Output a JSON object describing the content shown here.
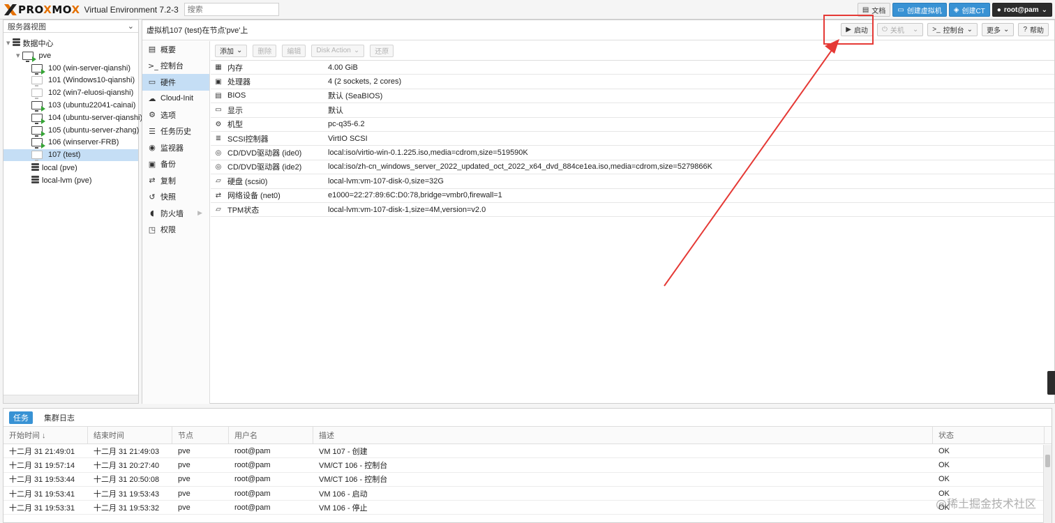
{
  "header": {
    "brand_main": "PRO",
    "brand_x2": "X",
    "brand_end": "MO",
    "brand_x3": "X",
    "version": "Virtual Environment 7.2-3",
    "search_placeholder": "搜索",
    "docs": "文档",
    "create_vm": "创建虚拟机",
    "create_ct": "创建CT",
    "user": "root@pam"
  },
  "tree": {
    "view": "服务器视图",
    "datacenter": "数据中心",
    "node": "pve",
    "vms": [
      {
        "label": "100 (win-server-qianshi)",
        "state": "running"
      },
      {
        "label": "101 (Windows10-qianshi)",
        "state": "stopped"
      },
      {
        "label": "102 (win7-eluosi-qianshi)",
        "state": "stopped"
      },
      {
        "label": "103 (ubuntu22041-cainai)",
        "state": "running"
      },
      {
        "label": "104 (ubuntu-server-qianshi)",
        "state": "running"
      },
      {
        "label": "105 (ubuntu-server-zhang)",
        "state": "running"
      },
      {
        "label": "106 (winserver-FRB)",
        "state": "running"
      },
      {
        "label": "107 (test)",
        "state": "selected"
      }
    ],
    "storage": [
      "local (pve)",
      "local-lvm (pve)"
    ]
  },
  "content": {
    "title": "虚拟机107 (test)在节点'pve'上",
    "buttons": {
      "start": "启动",
      "shutdown": "关机",
      "console": "控制台",
      "more": "更多",
      "help": "帮助"
    },
    "menu": [
      {
        "label": "概要",
        "icon": "book-icon"
      },
      {
        "label": "控制台",
        "icon": "terminal-icon"
      },
      {
        "label": "硬件",
        "icon": "desktop-icon"
      },
      {
        "label": "Cloud-Init",
        "icon": "cloud-icon"
      },
      {
        "label": "选项",
        "icon": "gear-icon"
      },
      {
        "label": "任务历史",
        "icon": "list-icon"
      },
      {
        "label": "监视器",
        "icon": "eye-icon"
      },
      {
        "label": "备份",
        "icon": "floppy-icon"
      },
      {
        "label": "复制",
        "icon": "retweet-icon"
      },
      {
        "label": "快照",
        "icon": "history-icon"
      },
      {
        "label": "防火墙",
        "icon": "shield-icon"
      },
      {
        "label": "权限",
        "icon": "unlock-icon"
      }
    ],
    "hw_toolbar": {
      "add": "添加",
      "remove": "删除",
      "edit": "编辑",
      "disk_action": "Disk Action",
      "revert": "还原"
    },
    "hardware": [
      {
        "name": "内存",
        "value": "4.00 GiB",
        "icon": "memory-icon"
      },
      {
        "name": "处理器",
        "value": "4 (2 sockets, 2 cores)",
        "icon": "cpu-icon"
      },
      {
        "name": "BIOS",
        "value": "默认 (SeaBIOS)",
        "icon": "microchip-icon"
      },
      {
        "name": "显示",
        "value": "默认",
        "icon": "monitor-icon"
      },
      {
        "name": "机型",
        "value": "pc-q35-6.2",
        "icon": "cogs-icon"
      },
      {
        "name": "SCSI控制器",
        "value": "VirtIO SCSI",
        "icon": "database-icon"
      },
      {
        "name": "CD/DVD驱动器 (ide0)",
        "value": "local:iso/virtio-win-0.1.225.iso,media=cdrom,size=519590K",
        "icon": "cdrom-icon"
      },
      {
        "name": "CD/DVD驱动器 (ide2)",
        "value": "local:iso/zh-cn_windows_server_2022_updated_oct_2022_x64_dvd_884ce1ea.iso,media=cdrom,size=5279866K",
        "icon": "cdrom-icon"
      },
      {
        "name": "硬盘 (scsi0)",
        "value": "local-lvm:vm-107-disk-0,size=32G",
        "icon": "hdd-icon"
      },
      {
        "name": "网络设备 (net0)",
        "value": "e1000=22:27:89:6C:D0:78,bridge=vmbr0,firewall=1",
        "icon": "exchange-icon"
      },
      {
        "name": "TPM状态",
        "value": "local-lvm:vm-107-disk-1,size=4M,version=v2.0",
        "icon": "hdd-icon"
      }
    ]
  },
  "tasks": {
    "tabs": [
      "任务",
      "集群日志"
    ],
    "columns": [
      "开始时间 ↓",
      "结束时间",
      "节点",
      "用户名",
      "描述",
      "状态"
    ],
    "rows": [
      [
        "十二月 31 21:49:01",
        "十二月 31 21:49:03",
        "pve",
        "root@pam",
        "VM 107 - 创建",
        "OK"
      ],
      [
        "十二月 31 19:57:14",
        "十二月 31 20:27:40",
        "pve",
        "root@pam",
        "VM/CT 106 - 控制台",
        "OK"
      ],
      [
        "十二月 31 19:53:44",
        "十二月 31 20:50:08",
        "pve",
        "root@pam",
        "VM/CT 106 - 控制台",
        "OK"
      ],
      [
        "十二月 31 19:53:41",
        "十二月 31 19:53:43",
        "pve",
        "root@pam",
        "VM 106 - 启动",
        "OK"
      ],
      [
        "十二月 31 19:53:31",
        "十二月 31 19:53:32",
        "pve",
        "root@pam",
        "VM 106 - 停止",
        "OK"
      ]
    ]
  },
  "watermark": "@稀土掘金技术社区",
  "colors": {
    "accent": "#3892d4",
    "annotation": "#e53935",
    "brand": "#e57000",
    "running": "#36a436"
  }
}
